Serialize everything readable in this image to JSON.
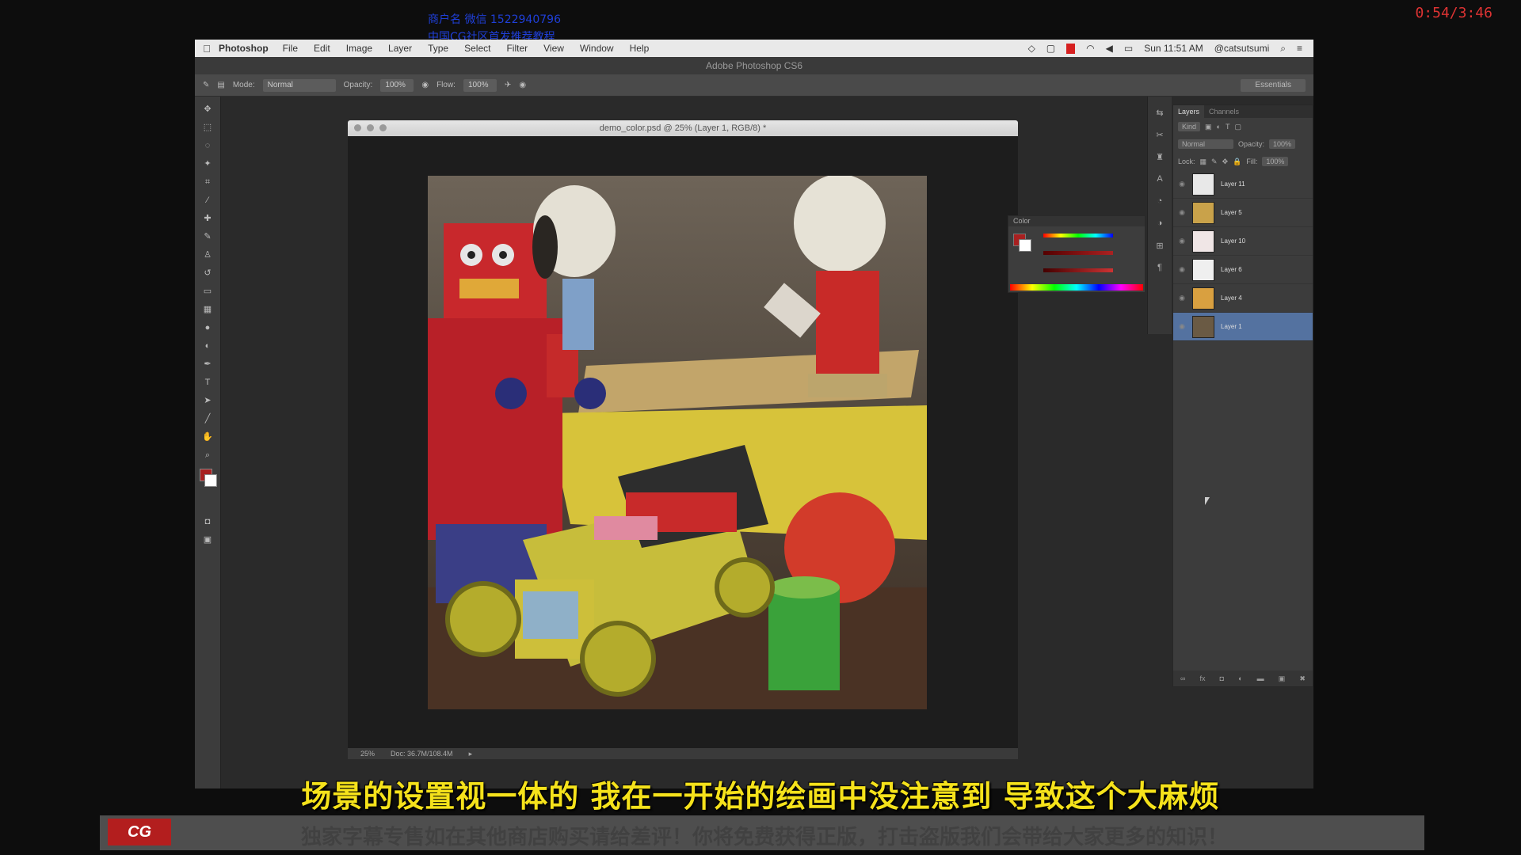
{
  "watermark": {
    "line1": "商户名 微信 1522940796",
    "line2": "中国CG社区首发推荐教程"
  },
  "timer": "0:54/3:46",
  "menubar": {
    "app": "Photoshop",
    "items": [
      "File",
      "Edit",
      "Image",
      "Layer",
      "Type",
      "Select",
      "Filter",
      "View",
      "Window",
      "Help"
    ],
    "clock": "Sun 11:51 AM",
    "user": "@catsutsumi",
    "status_color": "#d62020"
  },
  "app_title": "Adobe Photoshop CS6",
  "options": {
    "mode_label": "Mode:",
    "mode_value": "Normal",
    "opacity_label": "Opacity:",
    "opacity_value": "100%",
    "flow_label": "Flow:",
    "flow_value": "100%",
    "workspace": "Essentials"
  },
  "document": {
    "title": "demo_color.psd @ 25% (Layer 1, RGB/8) *",
    "zoom": "25%",
    "doc_size": "Doc: 36.7M/108.4M"
  },
  "color_panel": {
    "title": "Color",
    "foreground": "#a82020",
    "background": "#ffffff"
  },
  "layers_panel": {
    "tabs": [
      "Layers",
      "Channels"
    ],
    "kind": "Kind",
    "blend_mode": "Normal",
    "opacity_label": "Opacity:",
    "opacity_value": "100%",
    "lock_label": "Lock:",
    "fill_label": "Fill:",
    "fill_value": "100%",
    "layers": [
      {
        "name": "Layer 11",
        "color": "#e8e8e8"
      },
      {
        "name": "Layer 5",
        "color": "#c9a24a"
      },
      {
        "name": "Layer 10",
        "color": "#f0e6e6"
      },
      {
        "name": "Layer 6",
        "color": "#efefef"
      },
      {
        "name": "Layer 4",
        "color": "#d9a040"
      },
      {
        "name": "Layer 1",
        "color": "#6a5a44",
        "selected": true
      }
    ]
  },
  "subtitle": "场景的设置视一体的 我在一开始的绘画中没注意到 导致这个大麻烦",
  "banner": {
    "logo": "CG",
    "text": "独家字幕专售如在其他商店购买请给差评！你将免费获得正版，打击盗版我们会带给大家更多的知识！"
  }
}
